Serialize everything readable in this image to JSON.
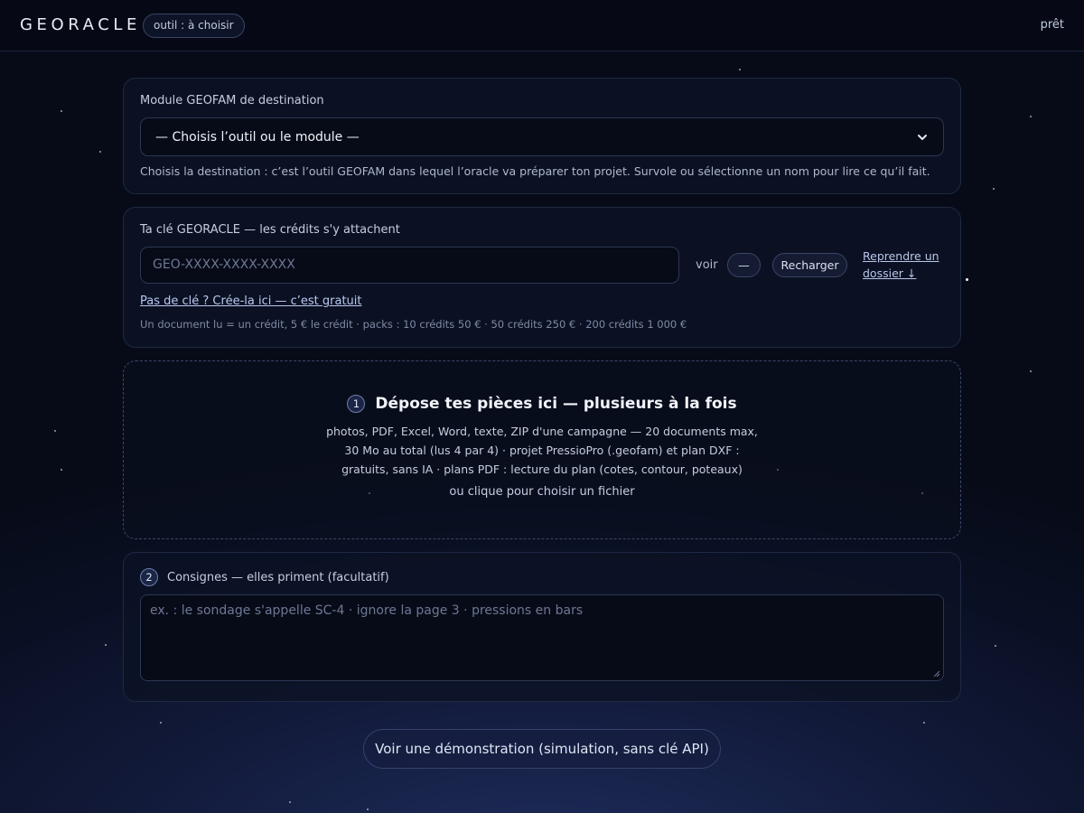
{
  "header": {
    "logo": "GEORACLE",
    "tool_pill": "outil : à choisir",
    "status": "prêt"
  },
  "module": {
    "label": "Module GEOFAM de destination",
    "select_value": "— Choisis l’outil ou le module —",
    "help": "Choisis la destination : c’est l’outil GEOFAM dans lequel l’oracle va préparer ton projet. Survole ou sélectionne un nom pour lire ce qu’il fait."
  },
  "key": {
    "label": "Ta clé GEORACLE — les crédits s'y attachent",
    "placeholder": "GEO-XXXX-XXXX-XXXX",
    "voir_label": "voir",
    "toggle_label": "—",
    "reload_label": "Recharger",
    "resume_link": "Reprendre un dossier ↓",
    "create_link": "Pas de clé ? Crée-la ici — c’est gratuit",
    "credits_info": "Un document lu = un crédit, 5 € le crédit · packs : 10 crédits 50 € · 50 crédits 250 € · 200 crédits 1 000 €"
  },
  "drop": {
    "step": "1",
    "title": "Dépose tes pièces ici — plusieurs à la fois",
    "description": "photos, PDF, Excel, Word, texte, ZIP d'une campagne — 20 documents max, 30 Mo au total (lus 4 par 4) · projet PressioPro (.geofam) et plan DXF : gratuits, sans IA · plans PDF : lecture du plan (cotes, contour, poteaux)",
    "click_text": "ou clique pour choisir un fichier"
  },
  "consignes": {
    "step": "2",
    "label": "Consignes — elles priment (facultatif)",
    "placeholder": "ex. : le sondage s'appelle SC-4 · ignore la page 3 · pressions en bars"
  },
  "demo_button": "Voir une démonstration (simulation, sans clé API)",
  "colors": {
    "background": "#0a1024",
    "card": "#0c1224",
    "link": "#b9c8f2",
    "text": "#dfe6f3"
  }
}
